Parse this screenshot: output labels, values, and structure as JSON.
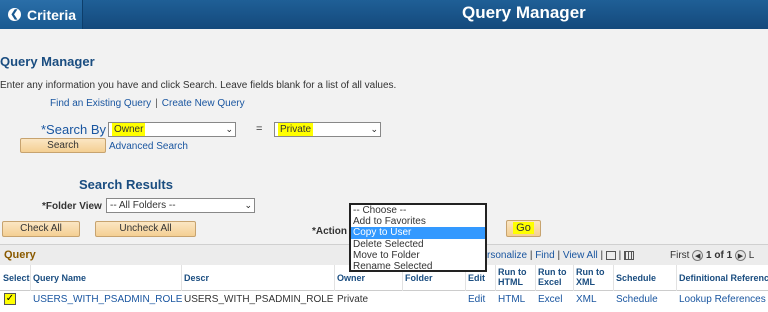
{
  "topbar": {
    "back_label": "Criteria",
    "title": "Query Manager"
  },
  "page": {
    "heading": "Query Manager",
    "instructions": "Enter any information you have and click Search. Leave fields blank for a list of all values.",
    "link_find": "Find an Existing Query",
    "link_sep": "|",
    "link_create": "Create New Query"
  },
  "search": {
    "by_label": "*Search By",
    "by_value": "Owner",
    "operator": "=",
    "value": "Private",
    "search_button": "Search",
    "advanced_link": "Advanced Search"
  },
  "results": {
    "heading": "Search Results",
    "folder_view_label": "*Folder View",
    "folder_view_value": "-- All Folders --",
    "check_all": "Check All",
    "uncheck_all": "Uncheck All",
    "action_label": "*Action",
    "action_options": [
      "-- Choose --",
      "Add to Favorites",
      "Copy to User",
      "Delete Selected",
      "Move to Folder",
      "Rename Selected"
    ],
    "action_selected_index": 2,
    "go_button": "Go"
  },
  "grid": {
    "title": "Query",
    "personalize": "rsonalize",
    "find": "Find",
    "view_all": "View All",
    "first": "First",
    "range": "1 of 1",
    "last": "L",
    "columns": [
      "Select",
      "Query Name",
      "Descr",
      "Owner",
      "Folder",
      "Edit",
      "Run to HTML",
      "Run to Excel",
      "Run to XML",
      "Schedule",
      "Definitional Reference"
    ],
    "rows": [
      {
        "checked": true,
        "query_name": "USERS_WITH_PSADMIN_ROLE",
        "descr": "USERS_WITH_PSADMIN_ROLE",
        "owner": "Private",
        "folder": "",
        "edit": "Edit",
        "html": "HTML",
        "excel": "Excel",
        "xml": "XML",
        "schedule": "Schedule",
        "defref": "Lookup References"
      }
    ]
  },
  "colors": {
    "header_blue": "#14497c",
    "highlight": "#ffff00",
    "link": "#1a56a0",
    "button": "#f4cf93"
  }
}
